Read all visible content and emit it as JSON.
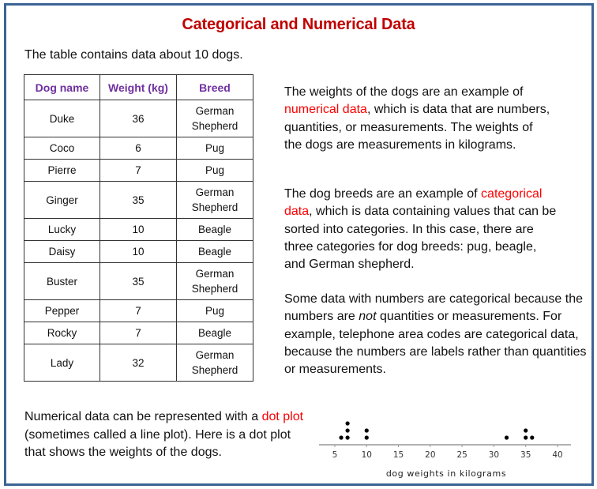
{
  "title": "Categorical and Numerical Data",
  "intro": "The table contains data about 10 dogs.",
  "table": {
    "headers": [
      "Dog name",
      "Weight (kg)",
      "Breed"
    ],
    "rows": [
      {
        "name": "Duke",
        "weight": "36",
        "breed_line1": "German",
        "breed_line2": "Shepherd"
      },
      {
        "name": "Coco",
        "weight": "6",
        "breed_line1": "Pug",
        "breed_line2": ""
      },
      {
        "name": "Pierre",
        "weight": "7",
        "breed_line1": "Pug",
        "breed_line2": ""
      },
      {
        "name": "Ginger",
        "weight": "35",
        "breed_line1": "German",
        "breed_line2": "Shepherd"
      },
      {
        "name": "Lucky",
        "weight": "10",
        "breed_line1": "Beagle",
        "breed_line2": ""
      },
      {
        "name": "Daisy",
        "weight": "10",
        "breed_line1": "Beagle",
        "breed_line2": ""
      },
      {
        "name": "Buster",
        "weight": "35",
        "breed_line1": "German",
        "breed_line2": "Shepherd"
      },
      {
        "name": "Pepper",
        "weight": "7",
        "breed_line1": "Pug",
        "breed_line2": ""
      },
      {
        "name": "Rocky",
        "weight": "7",
        "breed_line1": "Beagle",
        "breed_line2": ""
      },
      {
        "name": "Lady",
        "weight": "32",
        "breed_line1": "German",
        "breed_line2": "Shepherd"
      }
    ]
  },
  "paragraphs": {
    "numerical": {
      "before": "The weights of the dogs are an example of ",
      "highlight": "numerical data",
      "after": ", which is data that are numbers, quantities, or measurements. The weights of the dogs are measurements in kilograms."
    },
    "categorical": {
      "before": "The dog breeds are an example of ",
      "highlight": "categorical data",
      "after": ", which is data containing values that can be sorted into categories. In this case, there are three categories for dog breeds: pug, beagle, and German shepherd."
    },
    "numbers": {
      "before": "Some data with numbers are categorical because the numbers are ",
      "emphasis": "not",
      "after": " quantities or measurements. For example, telephone area codes are categorical data, because the numbers are labels rather than quantities or measurements."
    },
    "dotplot": {
      "before": "Numerical data can be represented with a ",
      "highlight": "dot plot",
      "after": " (sometimes called a line plot). Here is a dot plot that shows the weights of the dogs."
    }
  },
  "colors": {
    "title": "#c00000",
    "header": "#7030a0",
    "highlight": "#ff0000",
    "frame": "#3b6494"
  },
  "chart_data": {
    "type": "scatter",
    "subtype": "dot plot",
    "title": "",
    "xlabel": "dog weights in kilograms",
    "ylabel": "",
    "x_ticks": [
      5,
      10,
      15,
      20,
      25,
      30,
      35,
      40
    ],
    "xlim": [
      2.5,
      42.5
    ],
    "values": [
      36,
      6,
      7,
      35,
      10,
      10,
      35,
      7,
      7,
      32
    ],
    "counts": {
      "6": 1,
      "7": 3,
      "10": 2,
      "32": 1,
      "35": 2,
      "36": 1
    },
    "grid": false,
    "legend": "none"
  }
}
